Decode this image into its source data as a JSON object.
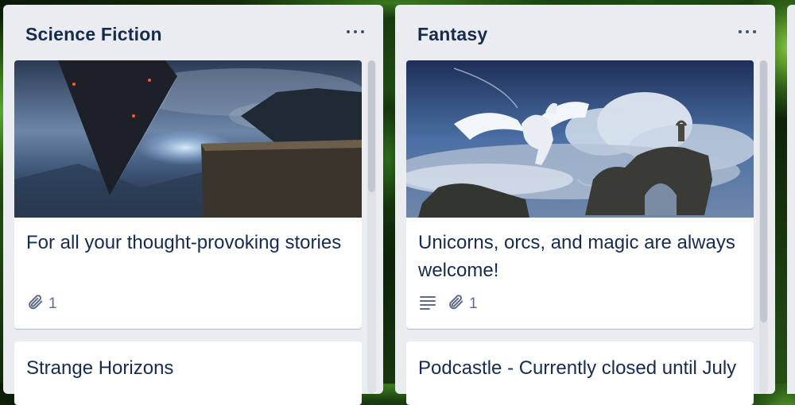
{
  "lists": [
    {
      "title": "Science Fiction",
      "cards": [
        {
          "title": "For all your thought-provoking stories",
          "has_cover": true,
          "badges": {
            "attachments": "1"
          }
        },
        {
          "title": "Strange Horizons"
        }
      ]
    },
    {
      "title": "Fantasy",
      "cards": [
        {
          "title": "Unicorns, orcs, and magic are always welcome!",
          "has_cover": true,
          "badges": {
            "attachments": "1",
            "description": true
          }
        },
        {
          "title": "Podcastle - Currently closed until July"
        }
      ]
    }
  ],
  "colors": {
    "list_bg": "#ebecf0",
    "card_bg": "#ffffff",
    "title_text": "#172b4d",
    "badge_text": "#5e6c84"
  },
  "icons": [
    "more-horizontal-icon",
    "paperclip-icon",
    "description-icon"
  ]
}
